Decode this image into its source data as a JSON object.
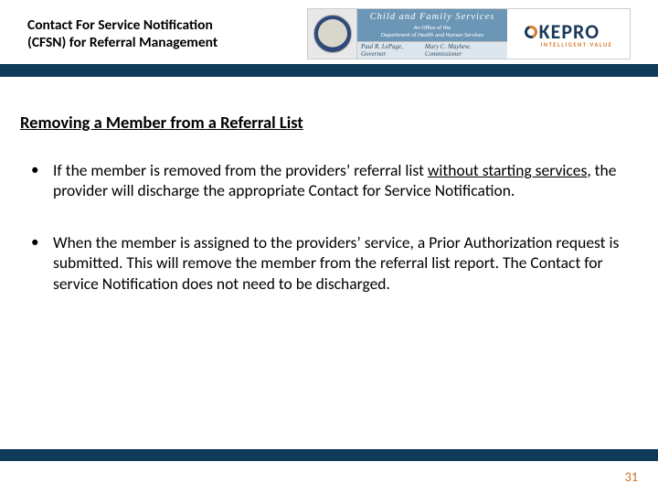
{
  "header": {
    "title_line1": "Contact For Service Notification",
    "title_line2": "(CFSN) for Referral Management",
    "cfs_line1": "Child and Family Services",
    "cfs_line2": "An Office of the",
    "cfs_line3": "Department of Health and Human Services",
    "name_left": "Paul R. LePage, Governor",
    "name_right": "Mary C. Mayhew, Commissioner",
    "kepro_text": "KEPRO",
    "kepro_tag": "INTELLIGENT VALUE"
  },
  "content": {
    "section_title": "Removing a Member from a Referral List",
    "bullet1_pre": "If the member is removed from the providers’ referral list ",
    "bullet1_u": "without starting services",
    "bullet1_post": ", the provider will discharge the appropriate Contact for Service Notification.",
    "bullet2": "When the member is assigned to the providers’ service, a Prior Authorization request is submitted. This will remove the member from the referral list report. The Contact for service Notification does not need to be discharged."
  },
  "page_number": "31",
  "colors": {
    "bar": "#0f3a5a",
    "accent": "#d06a1e"
  }
}
